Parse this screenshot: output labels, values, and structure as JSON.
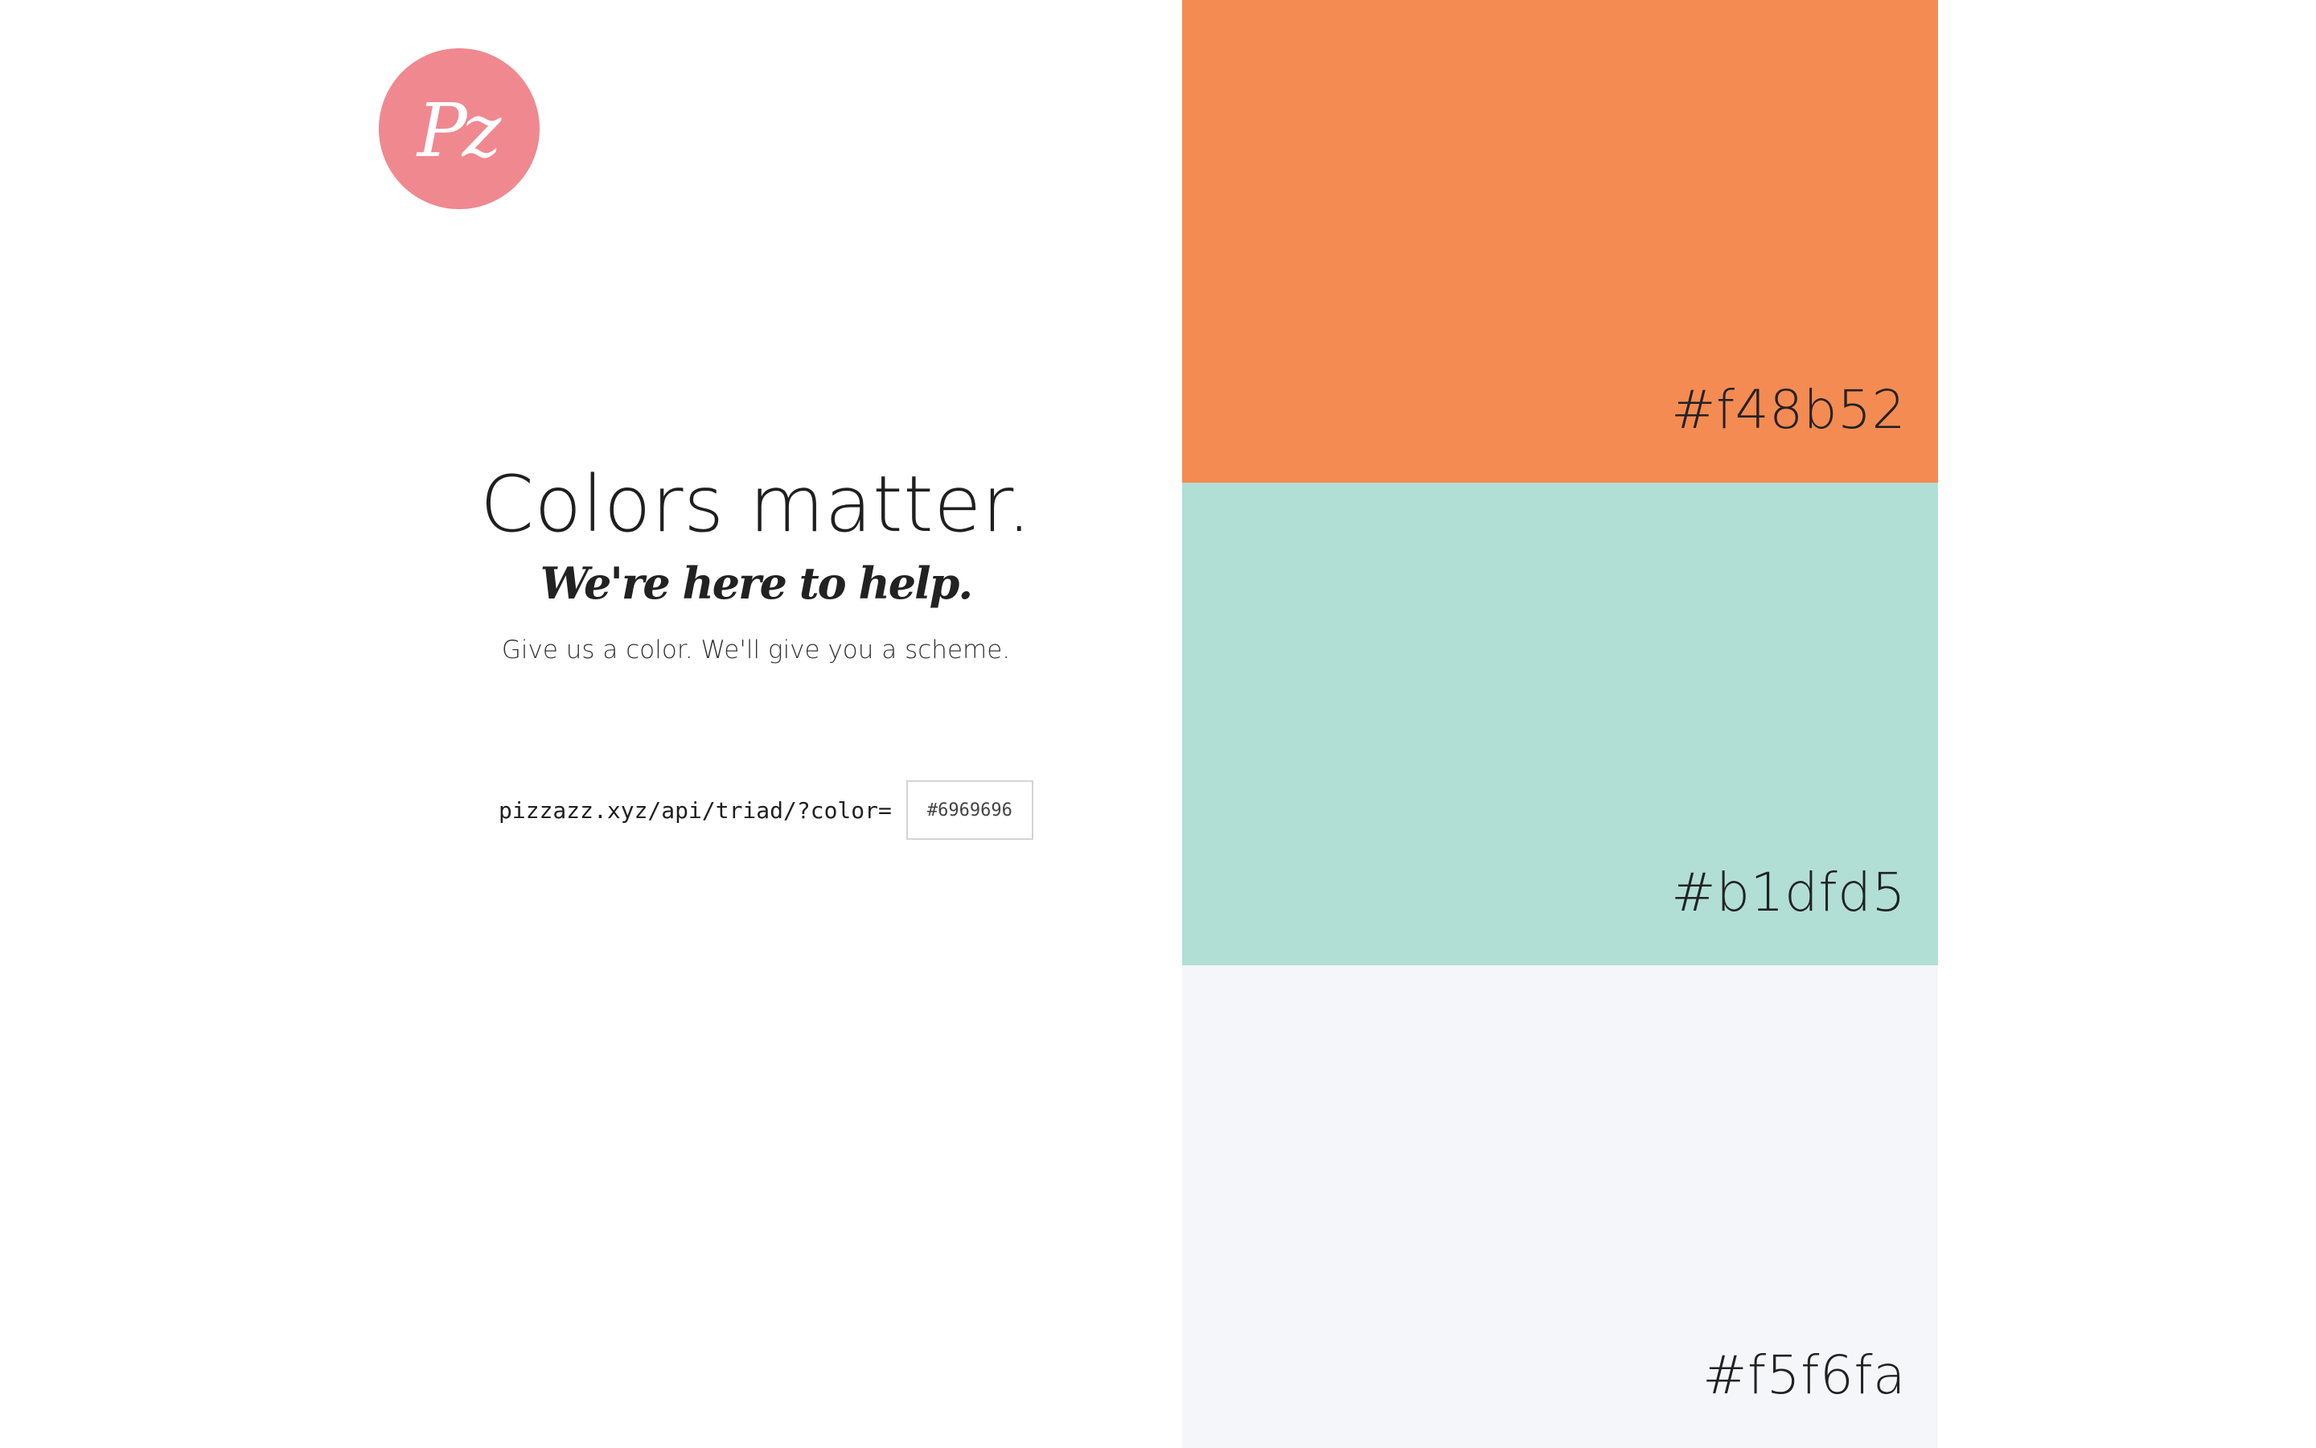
{
  "logo": {
    "text": "Pz",
    "color": "#f08890"
  },
  "hero": {
    "headline": "Colors matter.",
    "tagline": "We're here to help.",
    "subline": "Give us a color. We'll give you a scheme."
  },
  "api": {
    "label": "pizzazz.xyz/api/triad/?color=",
    "placeholder": "#6969696",
    "value": ""
  },
  "swatches": [
    {
      "hex": "#f48b52",
      "color": "#f48b52"
    },
    {
      "hex": "#b1dfd5",
      "color": "#b1dfd5"
    },
    {
      "hex": "#f5f6fa",
      "color": "#f5f6fa"
    }
  ]
}
